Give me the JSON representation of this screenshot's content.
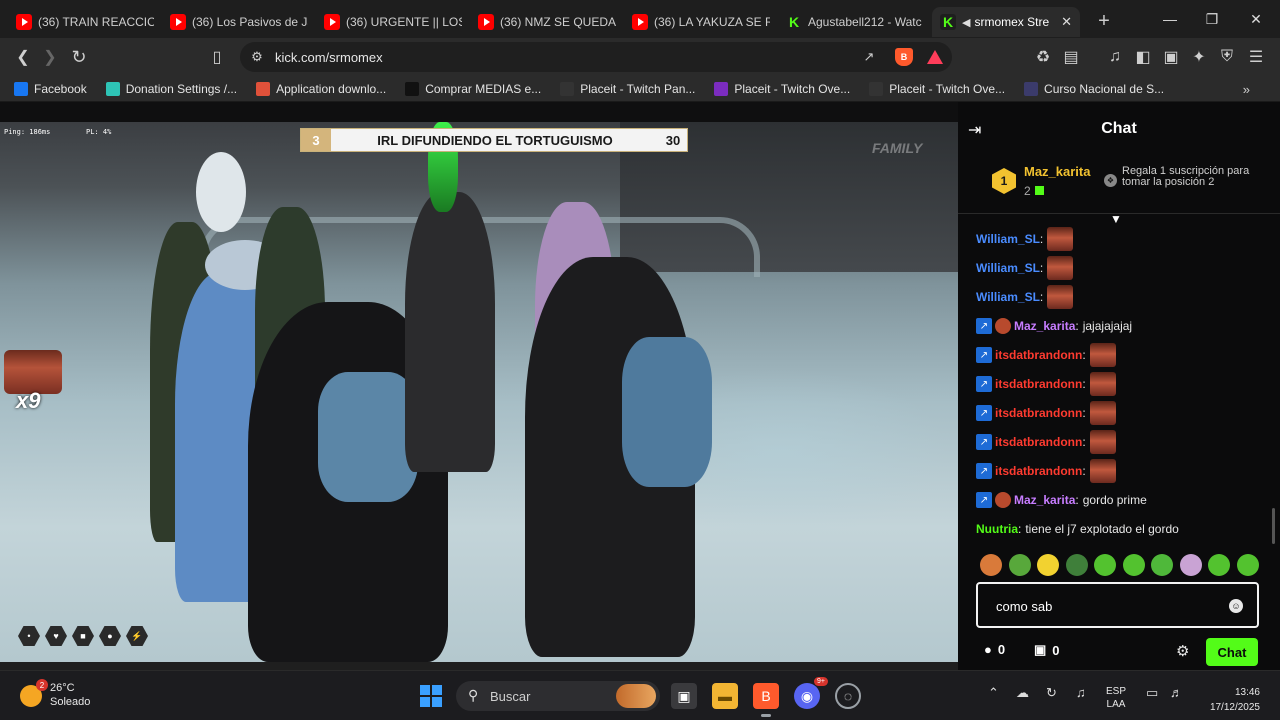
{
  "browser": {
    "tabs": [
      {
        "label": "(36) TRAIN REACCION",
        "favicon": "youtube-icon"
      },
      {
        "label": "(36) Los Pasivos de Ja",
        "favicon": "youtube-icon"
      },
      {
        "label": "(36) URGENTE || LOS I",
        "favicon": "youtube-icon"
      },
      {
        "label": "(36) NMZ SE QUEDAN",
        "favicon": "youtube-icon"
      },
      {
        "label": "(36) LA YAKUZA SE R",
        "favicon": "youtube-icon"
      },
      {
        "label": "Agustabell212 - Watc",
        "favicon": "kick-icon"
      },
      {
        "label": "srmomex Stre",
        "favicon": "kick-icon",
        "active": true,
        "playing_audio": true
      }
    ],
    "url": "kick.com/srmomex",
    "bookmarks": [
      {
        "label": "Facebook",
        "icon": "facebook-icon",
        "color": "#1877f2"
      },
      {
        "label": "Donation Settings /...",
        "icon": "streamlabs-icon",
        "color": "#2ec4b6"
      },
      {
        "label": "Application downlo...",
        "icon": "image-icon",
        "color": "#e0513a"
      },
      {
        "label": "Comprar MEDIAS e...",
        "icon": "shop-icon",
        "color": "#111111"
      },
      {
        "label": "Placeit - Twitch Pan...",
        "icon": "placeit-icon",
        "color": "#333333"
      },
      {
        "label": "Placeit - Twitch Ove...",
        "icon": "placeit-p-icon",
        "color": "#7b2cbf"
      },
      {
        "label": "Placeit - Twitch Ove...",
        "icon": "placeit-icon",
        "color": "#333333"
      },
      {
        "label": "Curso Nacional de S...",
        "icon": "shield-icon",
        "color": "#3b3b6b"
      }
    ]
  },
  "video": {
    "hud_ping": "Ping: 186ms",
    "hud_pl": "PL: 4%",
    "banner_left": "3",
    "banner_title": "IRL DIFUNDIENDO EL TORTUGUISMO",
    "banner_right": "30",
    "watermark": "FAMILY",
    "emote_count": "x9"
  },
  "chat": {
    "title": "Chat",
    "pinned": {
      "rank": "1",
      "username": "Maz_karita",
      "sub_count": "2",
      "cta": "Regala 1 suscripción para tomar la posición 2"
    },
    "messages": [
      {
        "user": "William_SL",
        "color": "#4a8cff",
        "text": "",
        "emote": true,
        "reply": false,
        "badge": false
      },
      {
        "user": "William_SL",
        "color": "#4a8cff",
        "text": "",
        "emote": true,
        "reply": false,
        "badge": false
      },
      {
        "user": "William_SL",
        "color": "#4a8cff",
        "text": "",
        "emote": true,
        "reply": false,
        "badge": false
      },
      {
        "user": "Maz_karita",
        "color": "#c77dff",
        "text": "jajajajajaj",
        "emote": false,
        "reply": true,
        "badge": true
      },
      {
        "user": "itsdatbrandonn",
        "color": "#ff3b30",
        "text": "",
        "emote": true,
        "reply": true,
        "badge": false
      },
      {
        "user": "itsdatbrandonn",
        "color": "#ff3b30",
        "text": "",
        "emote": true,
        "reply": true,
        "badge": false
      },
      {
        "user": "itsdatbrandonn",
        "color": "#ff3b30",
        "text": "",
        "emote": true,
        "reply": true,
        "badge": false
      },
      {
        "user": "itsdatbrandonn",
        "color": "#ff3b30",
        "text": "",
        "emote": true,
        "reply": true,
        "badge": false
      },
      {
        "user": "itsdatbrandonn",
        "color": "#ff3b30",
        "text": "",
        "emote": true,
        "reply": true,
        "badge": false
      },
      {
        "user": "Maz_karita",
        "color": "#c77dff",
        "text": "gordo prime",
        "emote": false,
        "reply": true,
        "badge": true
      },
      {
        "user": "Nuutria",
        "color": "#53fc18",
        "text": "tiene el j7 explotado el gordo",
        "emote": false,
        "reply": false,
        "badge": false
      }
    ],
    "input_value": "como sab",
    "footer": {
      "count_a": "0",
      "count_b": "0",
      "send_label": "Chat"
    }
  },
  "taskbar": {
    "weather_temp": "26°C",
    "weather_desc": "Soleado",
    "weather_badge": "2",
    "search_placeholder": "Buscar",
    "discord_badge": "9+",
    "lang_top": "ESP",
    "lang_bottom": "LAA",
    "time": "13:46",
    "date": "17/12/2025"
  },
  "colors": {
    "kick_green": "#53fc18",
    "chat_bg": "#0b0b0c",
    "browser_bg": "#2b2b2b"
  }
}
